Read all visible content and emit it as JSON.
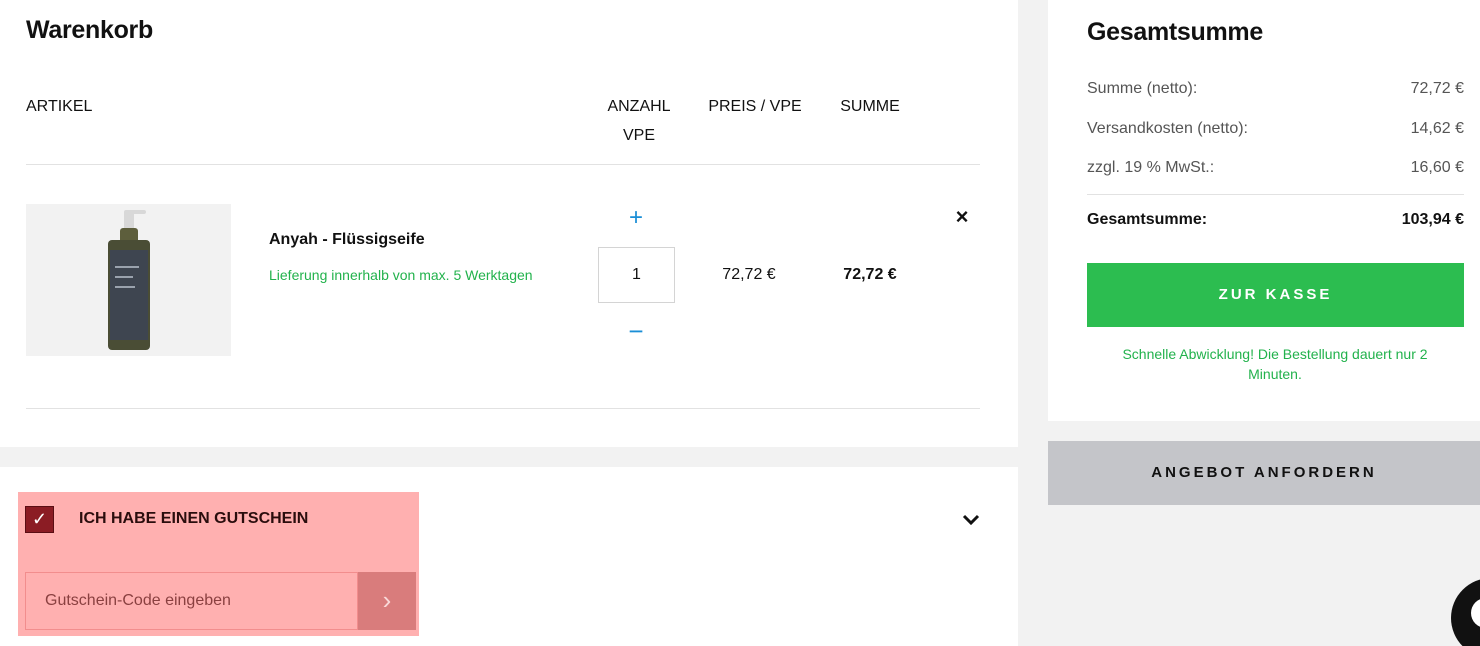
{
  "cart": {
    "title": "Warenkorb",
    "columns": {
      "artikel": "ARTIKEL",
      "anzahl_line1": "ANZAHL",
      "anzahl_line2": "VPE",
      "preis": "PREIS / VPE",
      "summe": "SUMME"
    },
    "items": [
      {
        "name": "Anyah - Flüssigseife",
        "delivery": "Lieferung innerhalb von max. 5 Werktagen",
        "quantity": "1",
        "plus": "+",
        "minus": "−",
        "unit_price": "72,72 €",
        "line_total": "72,72 €",
        "remove": "×"
      }
    ]
  },
  "voucher": {
    "checked": true,
    "check_mark": "✓",
    "label": "ICH HABE EINEN GUTSCHEIN",
    "placeholder": "Gutschein-Code eingeben",
    "submit_symbol": "›"
  },
  "summary": {
    "title": "Gesamtsumme",
    "rows": [
      {
        "label": "Summe (netto):",
        "value": "72,72 €"
      },
      {
        "label": "Versandkosten (netto):",
        "value": "14,62 €"
      },
      {
        "label": "zzgl. 19 % MwSt.:",
        "value": "16,60 €"
      }
    ],
    "total_label": "Gesamtsumme:",
    "total_value": "103,94 €",
    "checkout_label": "ZUR KASSE",
    "checkout_note": "Schnelle Abwicklung! Die Bestellung dauert nur 2 Minuten.",
    "offer_label": "ANGEBOT ANFORDERN"
  },
  "colors": {
    "accent_green": "#2cbd50",
    "qty_blue": "#1a8ed6",
    "voucher_bg": "#ffb0b0",
    "checkbox": "#8b1c24",
    "offer_gray": "#c4c5c9"
  },
  "icons": {
    "remove": "close-icon",
    "collapse": "chevron-down-icon",
    "submit": "chevron-right-icon",
    "chat": "chat-icon"
  }
}
